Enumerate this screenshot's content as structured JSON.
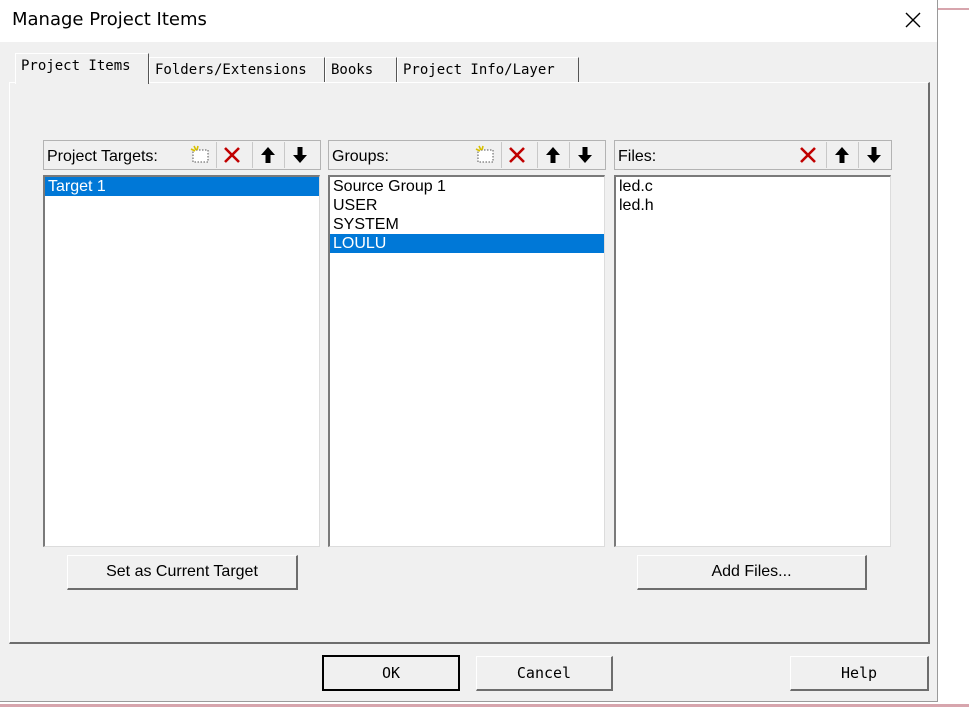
{
  "window": {
    "title": "Manage Project Items"
  },
  "tabs": [
    {
      "label": "Project Items"
    },
    {
      "label": "Folders/Extensions"
    },
    {
      "label": "Books"
    },
    {
      "label": "Project Info/Layer"
    }
  ],
  "targets": {
    "label": "Project Targets:",
    "items": [
      "Target 1"
    ],
    "selected": "Target 1",
    "button": "Set as Current Target"
  },
  "groups": {
    "label": "Groups:",
    "items": [
      "Source Group 1",
      "USER",
      "SYSTEM",
      "LOULU"
    ],
    "selected": "LOULU"
  },
  "files": {
    "label": "Files:",
    "items": [
      "led.c",
      "led.h"
    ],
    "button": "Add Files..."
  },
  "footer": {
    "ok": "OK",
    "cancel": "Cancel",
    "help": "Help"
  },
  "colors": {
    "selection": "#0078d7",
    "delete_icon": "#c00000",
    "new_icon": "#e8d200"
  },
  "icons": [
    "new-item-icon",
    "delete-icon",
    "move-up-icon",
    "move-down-icon",
    "close-icon"
  ]
}
